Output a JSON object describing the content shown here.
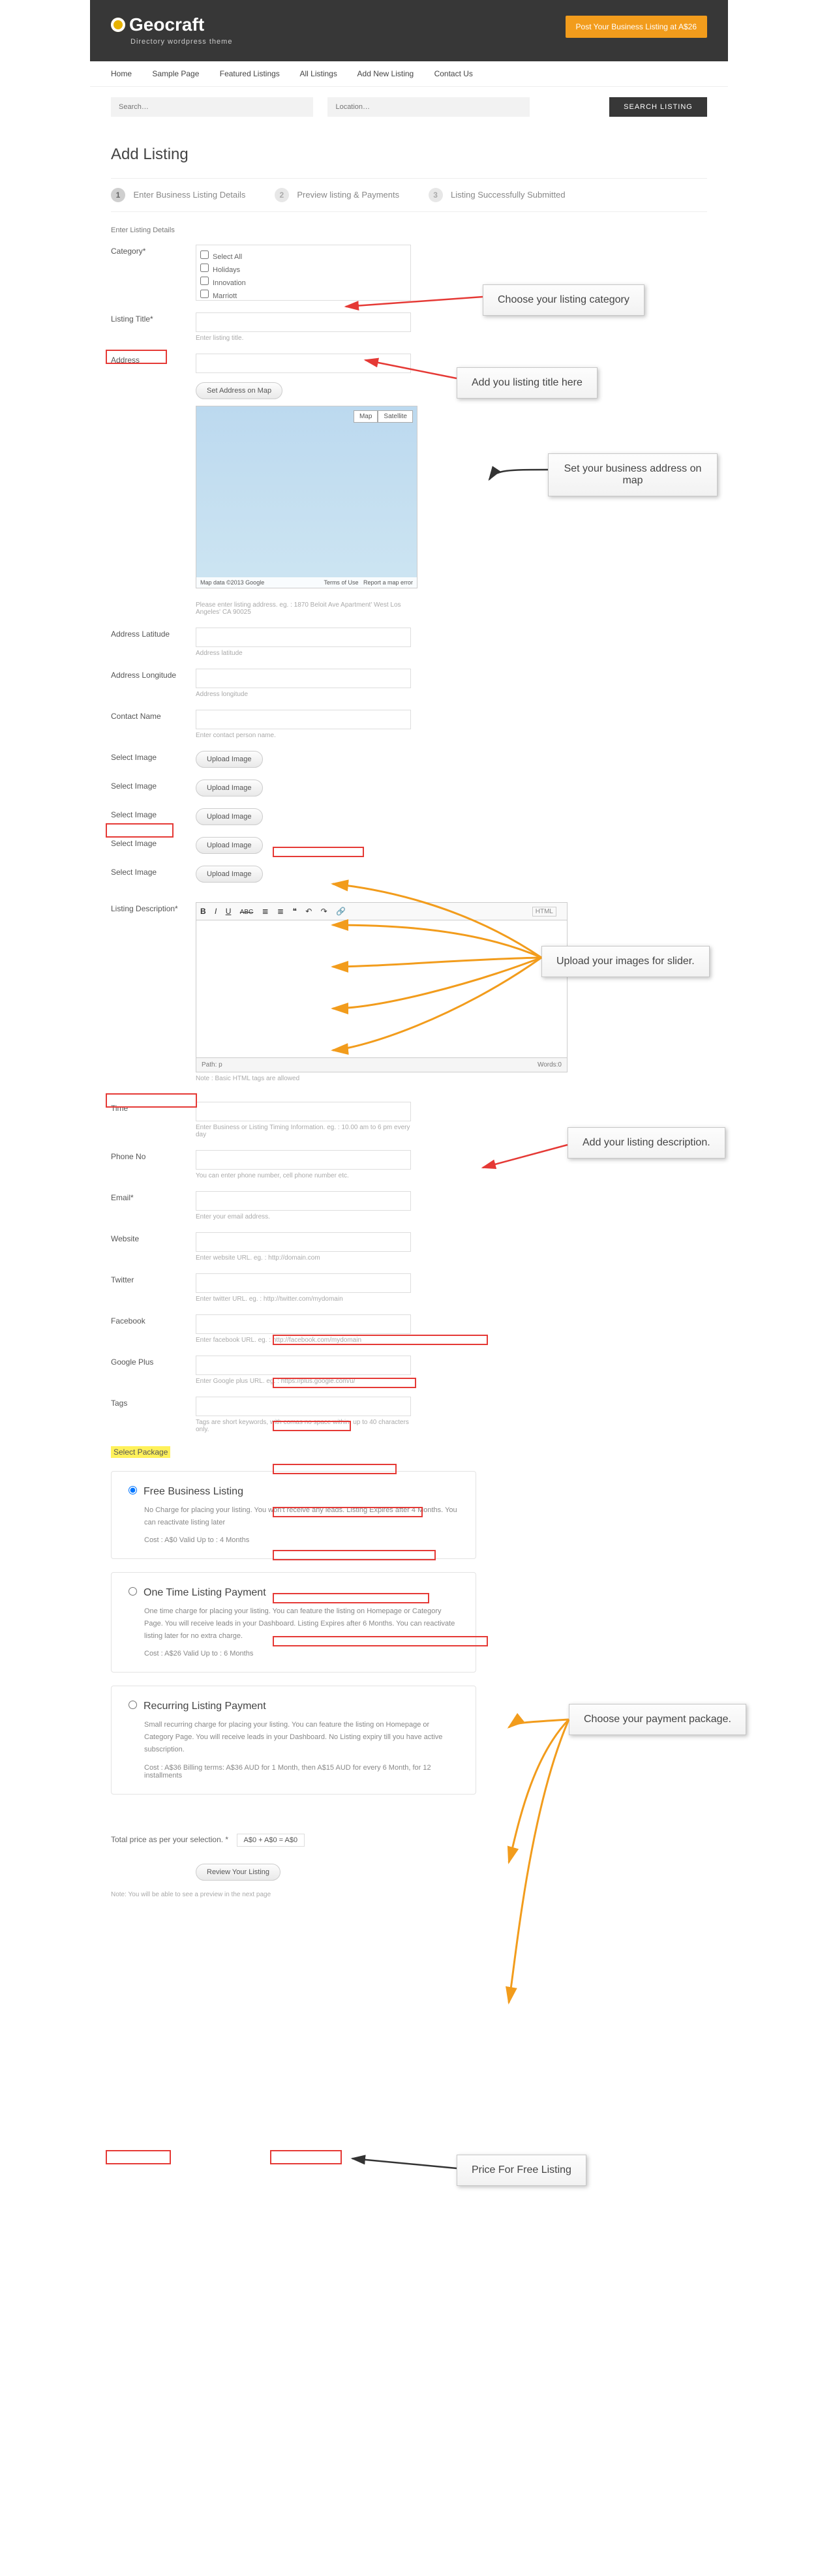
{
  "header": {
    "brand": "Geocraft",
    "tagline": "Directory wordpress theme",
    "cta": "Post Your Business Listing at A$26"
  },
  "nav": [
    "Home",
    "Sample Page",
    "Featured Listings",
    "All Listings",
    "Add New Listing",
    "Contact Us"
  ],
  "search": {
    "ph_search": "Search…",
    "ph_location": "Location…",
    "btn": "SEARCH LISTING"
  },
  "page": {
    "title": "Add Listing",
    "section_label": "Enter Listing Details"
  },
  "steps": [
    {
      "n": "1",
      "t": "Enter Business Listing Details"
    },
    {
      "n": "2",
      "t": "Preview listing & Payments"
    },
    {
      "n": "3",
      "t": "Listing Successfully Submitted"
    }
  ],
  "labels": {
    "category": "Category*",
    "title": "Listing Title*",
    "address": "Address",
    "lat": "Address Latitude",
    "lng": "Address Longitude",
    "contact": "Contact Name",
    "image": "Select Image",
    "desc": "Listing Description*",
    "time": "Time",
    "phone": "Phone No",
    "email": "Email*",
    "website": "Website",
    "twitter": "Twitter",
    "facebook": "Facebook",
    "gplus": "Google Plus",
    "tags": "Tags",
    "select_pkg": "Select Package"
  },
  "cats": [
    "Select All",
    "Holidays",
    "Innovation",
    "Marriott"
  ],
  "hints": {
    "title": "Enter listing title.",
    "map_btn": "Set Address on Map",
    "addr_note": "Please enter listing address. eg. : 1870 Beloit Ave Apartment' West Los Angeles' CA 90025",
    "lat": "Address latitude",
    "lng": "Address longitude",
    "contact_ph": "Enter contact person name.",
    "upload": "Upload Image",
    "editor_note": "Note : Basic HTML tags are allowed",
    "path_label": "Path: p",
    "words_label": "Words:0",
    "total_prefix": "Total price as per your selection. *",
    "total_val": "A$0 + A$0 = A$0",
    "review_btn": "Review Your Listing",
    "review_note": "Note: You will be able to see a preview in the next page"
  },
  "placeholders": {
    "time": "Enter Business or Listing Timing Information. eg. : 10.00 am to 6 pm every day",
    "phone": "You can enter phone number, cell phone number etc.",
    "email": "Enter your email address.",
    "website": "Enter website URL. eg. : http://domain.com",
    "twitter": "Enter twitter URL. eg. : http://twitter.com/mydomain",
    "facebook": "Enter facebook URL. eg. : http://facebook.com/mydomain",
    "gplus": "Enter Google plus URL. eg. : https://plus.google.com/u/",
    "tags": "Tags are short keywords, with comas no space within. up to 40 characters only."
  },
  "map": {
    "btn_map": "Map",
    "btn_sat": "Satellite",
    "credit": "Map data ©2013 Google",
    "tou": "Terms of Use",
    "report": "Report a map error"
  },
  "packages": [
    {
      "title": "Free Business Listing",
      "desc": "No Charge for placing your listing. You won't receive any leads. Listing Expires after 4 Months. You can reactivate listing later",
      "meta": "Cost : A$0      Valid Up to : 4 Months"
    },
    {
      "title": "One Time Listing Payment",
      "desc": "One time charge for placing your listing. You can feature the listing on Homepage or Category Page. You will receive leads in your Dashboard. Listing Expires after 6 Months. You can reactivate listing later for no extra charge.",
      "meta": "Cost : A$26      Valid Up to : 6 Months"
    },
    {
      "title": "Recurring Listing Payment",
      "desc": "Small recurring charge for placing your listing. You can feature the listing on Homepage or Category Page. You will receive leads in your Dashboard. No Listing expiry till you have active subscription.",
      "meta": "Cost : A$36      Billing terms: A$36 AUD for 1 Month, then A$15 AUD for every 6 Month, for 12 installments"
    }
  ],
  "toolbar": {
    "b": "B",
    "i": "I",
    "u": "U",
    "s": "ABC",
    "html": "HTML"
  },
  "callouts": {
    "cat": "Choose your listing category",
    "title": "Add you listing title here",
    "map": "Set your business address on map",
    "imgs": "Upload your images for slider.",
    "desc": "Add your listing description.",
    "pkg": "Choose your payment package.",
    "price": "Price For Free Listing"
  }
}
